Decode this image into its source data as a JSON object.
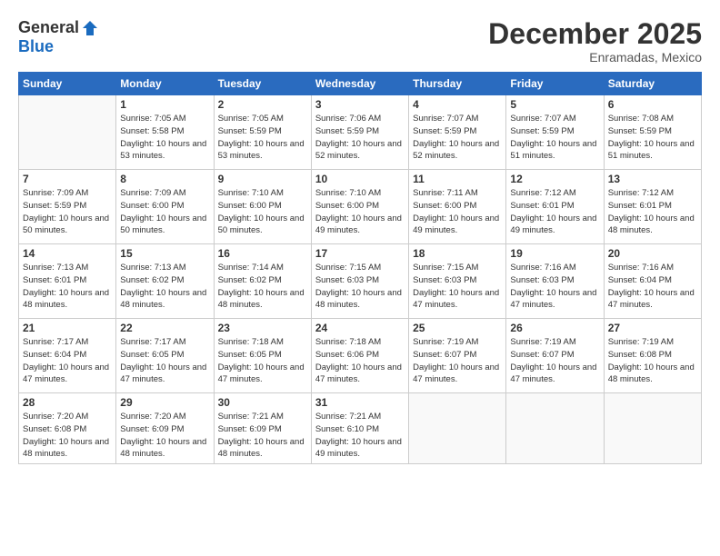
{
  "logo": {
    "general": "General",
    "blue": "Blue"
  },
  "title": "December 2025",
  "location": "Enramadas, Mexico",
  "weekdays": [
    "Sunday",
    "Monday",
    "Tuesday",
    "Wednesday",
    "Thursday",
    "Friday",
    "Saturday"
  ],
  "weeks": [
    [
      {
        "day": "",
        "sunrise": "",
        "sunset": "",
        "daylight": ""
      },
      {
        "day": "1",
        "sunrise": "Sunrise: 7:05 AM",
        "sunset": "Sunset: 5:58 PM",
        "daylight": "Daylight: 10 hours and 53 minutes."
      },
      {
        "day": "2",
        "sunrise": "Sunrise: 7:05 AM",
        "sunset": "Sunset: 5:59 PM",
        "daylight": "Daylight: 10 hours and 53 minutes."
      },
      {
        "day": "3",
        "sunrise": "Sunrise: 7:06 AM",
        "sunset": "Sunset: 5:59 PM",
        "daylight": "Daylight: 10 hours and 52 minutes."
      },
      {
        "day": "4",
        "sunrise": "Sunrise: 7:07 AM",
        "sunset": "Sunset: 5:59 PM",
        "daylight": "Daylight: 10 hours and 52 minutes."
      },
      {
        "day": "5",
        "sunrise": "Sunrise: 7:07 AM",
        "sunset": "Sunset: 5:59 PM",
        "daylight": "Daylight: 10 hours and 51 minutes."
      },
      {
        "day": "6",
        "sunrise": "Sunrise: 7:08 AM",
        "sunset": "Sunset: 5:59 PM",
        "daylight": "Daylight: 10 hours and 51 minutes."
      }
    ],
    [
      {
        "day": "7",
        "sunrise": "Sunrise: 7:09 AM",
        "sunset": "Sunset: 5:59 PM",
        "daylight": "Daylight: 10 hours and 50 minutes."
      },
      {
        "day": "8",
        "sunrise": "Sunrise: 7:09 AM",
        "sunset": "Sunset: 6:00 PM",
        "daylight": "Daylight: 10 hours and 50 minutes."
      },
      {
        "day": "9",
        "sunrise": "Sunrise: 7:10 AM",
        "sunset": "Sunset: 6:00 PM",
        "daylight": "Daylight: 10 hours and 50 minutes."
      },
      {
        "day": "10",
        "sunrise": "Sunrise: 7:10 AM",
        "sunset": "Sunset: 6:00 PM",
        "daylight": "Daylight: 10 hours and 49 minutes."
      },
      {
        "day": "11",
        "sunrise": "Sunrise: 7:11 AM",
        "sunset": "Sunset: 6:00 PM",
        "daylight": "Daylight: 10 hours and 49 minutes."
      },
      {
        "day": "12",
        "sunrise": "Sunrise: 7:12 AM",
        "sunset": "Sunset: 6:01 PM",
        "daylight": "Daylight: 10 hours and 49 minutes."
      },
      {
        "day": "13",
        "sunrise": "Sunrise: 7:12 AM",
        "sunset": "Sunset: 6:01 PM",
        "daylight": "Daylight: 10 hours and 48 minutes."
      }
    ],
    [
      {
        "day": "14",
        "sunrise": "Sunrise: 7:13 AM",
        "sunset": "Sunset: 6:01 PM",
        "daylight": "Daylight: 10 hours and 48 minutes."
      },
      {
        "day": "15",
        "sunrise": "Sunrise: 7:13 AM",
        "sunset": "Sunset: 6:02 PM",
        "daylight": "Daylight: 10 hours and 48 minutes."
      },
      {
        "day": "16",
        "sunrise": "Sunrise: 7:14 AM",
        "sunset": "Sunset: 6:02 PM",
        "daylight": "Daylight: 10 hours and 48 minutes."
      },
      {
        "day": "17",
        "sunrise": "Sunrise: 7:15 AM",
        "sunset": "Sunset: 6:03 PM",
        "daylight": "Daylight: 10 hours and 48 minutes."
      },
      {
        "day": "18",
        "sunrise": "Sunrise: 7:15 AM",
        "sunset": "Sunset: 6:03 PM",
        "daylight": "Daylight: 10 hours and 47 minutes."
      },
      {
        "day": "19",
        "sunrise": "Sunrise: 7:16 AM",
        "sunset": "Sunset: 6:03 PM",
        "daylight": "Daylight: 10 hours and 47 minutes."
      },
      {
        "day": "20",
        "sunrise": "Sunrise: 7:16 AM",
        "sunset": "Sunset: 6:04 PM",
        "daylight": "Daylight: 10 hours and 47 minutes."
      }
    ],
    [
      {
        "day": "21",
        "sunrise": "Sunrise: 7:17 AM",
        "sunset": "Sunset: 6:04 PM",
        "daylight": "Daylight: 10 hours and 47 minutes."
      },
      {
        "day": "22",
        "sunrise": "Sunrise: 7:17 AM",
        "sunset": "Sunset: 6:05 PM",
        "daylight": "Daylight: 10 hours and 47 minutes."
      },
      {
        "day": "23",
        "sunrise": "Sunrise: 7:18 AM",
        "sunset": "Sunset: 6:05 PM",
        "daylight": "Daylight: 10 hours and 47 minutes."
      },
      {
        "day": "24",
        "sunrise": "Sunrise: 7:18 AM",
        "sunset": "Sunset: 6:06 PM",
        "daylight": "Daylight: 10 hours and 47 minutes."
      },
      {
        "day": "25",
        "sunrise": "Sunrise: 7:19 AM",
        "sunset": "Sunset: 6:07 PM",
        "daylight": "Daylight: 10 hours and 47 minutes."
      },
      {
        "day": "26",
        "sunrise": "Sunrise: 7:19 AM",
        "sunset": "Sunset: 6:07 PM",
        "daylight": "Daylight: 10 hours and 47 minutes."
      },
      {
        "day": "27",
        "sunrise": "Sunrise: 7:19 AM",
        "sunset": "Sunset: 6:08 PM",
        "daylight": "Daylight: 10 hours and 48 minutes."
      }
    ],
    [
      {
        "day": "28",
        "sunrise": "Sunrise: 7:20 AM",
        "sunset": "Sunset: 6:08 PM",
        "daylight": "Daylight: 10 hours and 48 minutes."
      },
      {
        "day": "29",
        "sunrise": "Sunrise: 7:20 AM",
        "sunset": "Sunset: 6:09 PM",
        "daylight": "Daylight: 10 hours and 48 minutes."
      },
      {
        "day": "30",
        "sunrise": "Sunrise: 7:21 AM",
        "sunset": "Sunset: 6:09 PM",
        "daylight": "Daylight: 10 hours and 48 minutes."
      },
      {
        "day": "31",
        "sunrise": "Sunrise: 7:21 AM",
        "sunset": "Sunset: 6:10 PM",
        "daylight": "Daylight: 10 hours and 49 minutes."
      },
      {
        "day": "",
        "sunrise": "",
        "sunset": "",
        "daylight": ""
      },
      {
        "day": "",
        "sunrise": "",
        "sunset": "",
        "daylight": ""
      },
      {
        "day": "",
        "sunrise": "",
        "sunset": "",
        "daylight": ""
      }
    ]
  ]
}
